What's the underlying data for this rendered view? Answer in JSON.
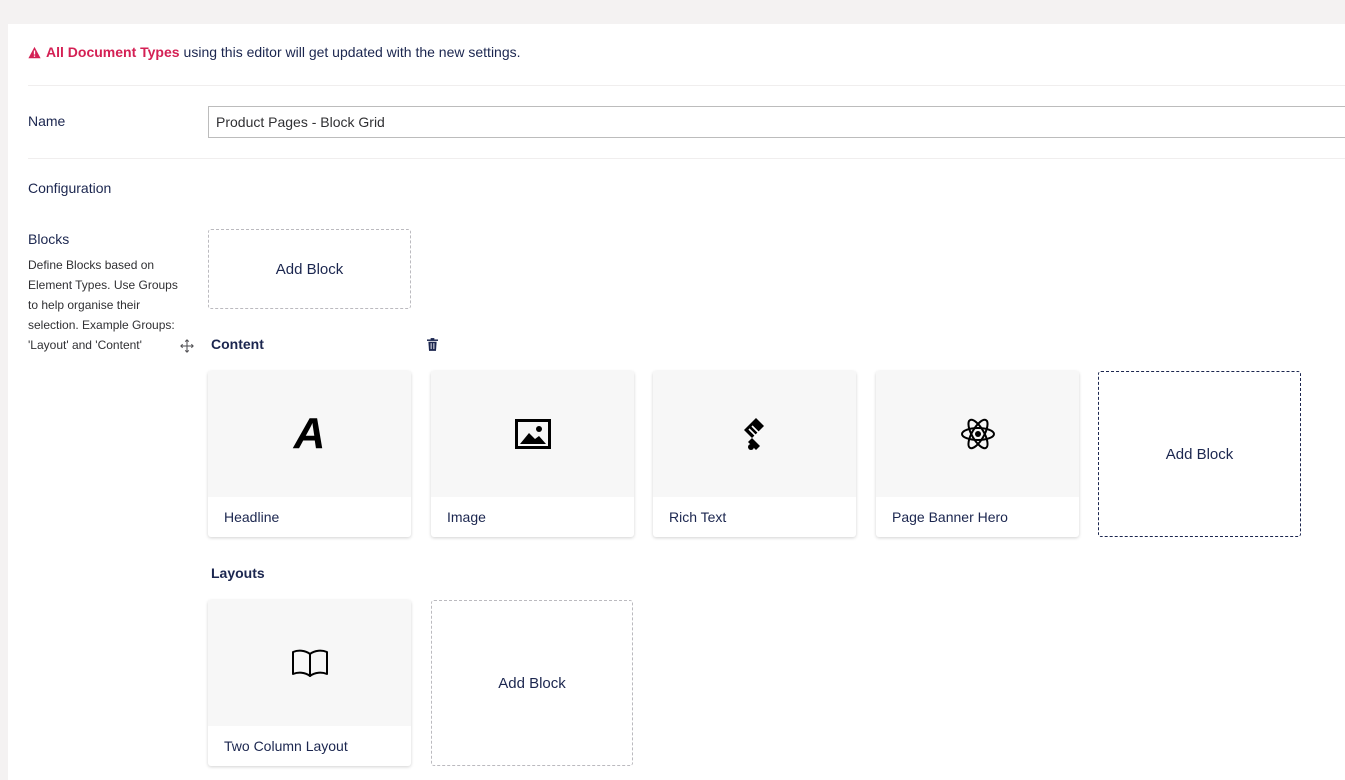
{
  "notice": {
    "highlight": "All Document Types",
    "text": "using this editor will get updated with the new settings.",
    "icon": "warning-triangle-icon"
  },
  "name_field": {
    "label": "Name",
    "value": "Product Pages - Block Grid"
  },
  "configuration": {
    "heading": "Configuration"
  },
  "blocks": {
    "label": "Blocks",
    "description": "Define Blocks based on Element Types. Use Groups to help organise their selection. Example Groups: 'Layout' and 'Content'",
    "add_block_label": "Add Block"
  },
  "groups": [
    {
      "name": "Content",
      "blocks": [
        {
          "title": "Headline",
          "icon": "letter-a-icon"
        },
        {
          "title": "Image",
          "icon": "picture-icon"
        },
        {
          "title": "Rich Text",
          "icon": "script-icon"
        },
        {
          "title": "Page Banner Hero",
          "icon": "atom-icon"
        }
      ],
      "add_block_label": "Add Block"
    },
    {
      "name": "Layouts",
      "blocks": [
        {
          "title": "Two Column Layout",
          "icon": "open-book-icon"
        }
      ],
      "add_block_label": "Add Block"
    }
  ],
  "colors": {
    "accent": "#d42054",
    "text": "#1b264f",
    "background": "#f4f2f2"
  }
}
